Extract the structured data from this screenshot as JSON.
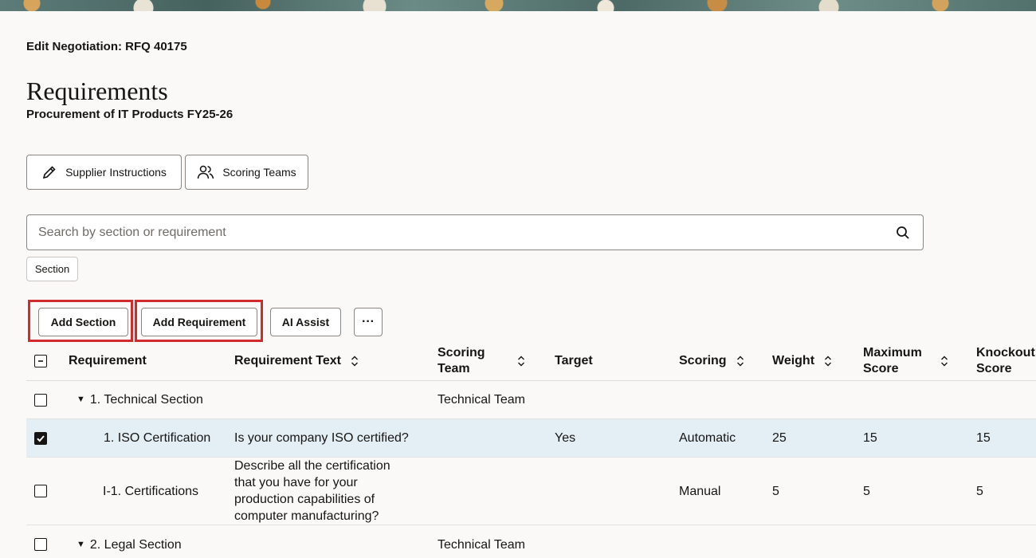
{
  "header": {
    "context": "Edit Negotiation: RFQ 40175",
    "title": "Requirements",
    "subtitle": "Procurement of IT Products FY25-26"
  },
  "actions": {
    "supplier_instructions": "Supplier Instructions",
    "scoring_teams": "Scoring Teams"
  },
  "search": {
    "placeholder": "Search by section or requirement",
    "value": ""
  },
  "filter_chip": "Section",
  "toolbar": {
    "add_section": "Add Section",
    "add_requirement": "Add Requirement",
    "ai_assist": "AI Assist",
    "more": "···"
  },
  "table": {
    "columns": {
      "requirement": "Requirement",
      "requirement_text": "Requirement Text",
      "scoring_team_1": "Scoring",
      "scoring_team_2": "Team",
      "target": "Target",
      "scoring": "Scoring",
      "weight": "Weight",
      "max_score_1": "Maximum",
      "max_score_2": "Score",
      "knockout_1": "Knockout",
      "knockout_2": "Score"
    },
    "rows": [
      {
        "caret": "▼",
        "requirement": "1. Technical Section",
        "text": "",
        "team": "Technical Team",
        "target": "",
        "scoring": "",
        "weight": "",
        "max": "",
        "knockout": ""
      },
      {
        "requirement": "1. ISO Certification",
        "text": "Is your company ISO certified?",
        "team": "",
        "target": "Yes",
        "scoring": "Automatic",
        "weight": "25",
        "max": "15",
        "knockout": "15"
      },
      {
        "requirement": "I-1. Certifications",
        "text_lines": [
          "Describe all the certification",
          "that you have for your",
          "production capabilities of",
          "computer manufacturing?"
        ],
        "team": "",
        "target": "",
        "scoring": "Manual",
        "weight": "5",
        "max": "5",
        "knockout": "5"
      },
      {
        "caret": "▼",
        "requirement": "2. Legal Section",
        "text": "",
        "team": "Technical Team",
        "target": "",
        "scoring": "",
        "weight": "",
        "max": "",
        "knockout": ""
      }
    ]
  },
  "colors": {
    "highlight": "#d12b2e",
    "selected_row": "#e4eef5",
    "background": "#fbf9f8"
  },
  "icons": [
    "pencil-icon",
    "people-icon",
    "search-icon",
    "sort-icon",
    "checkbox-icon",
    "caret-down-icon"
  ]
}
